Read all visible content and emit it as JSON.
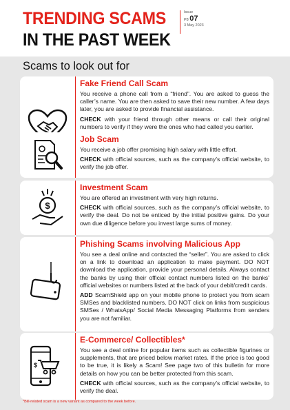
{
  "header": {
    "title_line1": "TRENDING SCAMS",
    "title_line2": "IN THE PAST WEEK",
    "issue_label": "Issue",
    "issue_prefix": "P8",
    "issue_number": "07",
    "issue_date": "3 May 2023"
  },
  "section_title": "Scams to look out for",
  "cards": [
    {
      "title": "Fake Friend Call Scam",
      "icon": "handshake-heart-icon",
      "paragraphs": [
        {
          "bold": "",
          "text": "You receive a phone call from a “friend”. You are asked to guess the caller’s name. You are then asked to save their new number. A few days later, you are asked to provide financial assistance."
        },
        {
          "bold": "CHECK",
          "text": " with your friend through other means or call their original numbers to verify if they were the ones who had called you earlier."
        }
      ]
    },
    {
      "title": "Job Scam",
      "icon": "resume-magnifier-icon",
      "paragraphs": [
        {
          "bold": "",
          "text": "You receive a job offer promising high salary with little effort."
        },
        {
          "bold": "CHECK",
          "text": " with official sources, such as the company’s official website, to verify the job offer."
        }
      ]
    },
    {
      "title": "Investment Scam",
      "icon": "money-hand-icon",
      "paragraphs": [
        {
          "bold": "",
          "text": "You are offered an investment with very high returns."
        },
        {
          "bold": "CHECK",
          "text": " with official sources, such as the company’s official website, to verify the deal. Do not be enticed by the initial positive gains. Do your own due diligence before you invest large sums of money."
        }
      ]
    },
    {
      "title": "Phishing Scams involving Malicious App",
      "icon": "phone-hook-icon",
      "paragraphs": [
        {
          "bold": "",
          "text": "You see a deal online and contacted the “seller”. You are asked to click on a link to download an application to make payment. DO NOT download the application, provide your personal details. Always contact the banks by using their official contact numbers listed on the banks’ official websites or numbers listed at the back of your debit/credit cards."
        },
        {
          "bold": "ADD",
          "text": " ScamShield app on your mobile phone to protect you from scam SMSes and blacklisted numbers. DO NOT click on links from suspicious SMSes / WhatsApp/ Social Media Messaging Platforms from senders you are not familiar."
        }
      ]
    },
    {
      "title": "E-Commerce/ Collectibles*",
      "icon": "phone-cart-icon",
      "paragraphs": [
        {
          "bold": "",
          "text": "You see a deal online for popular items such as collectible figurines or supplements, that are priced below market rates. If the price is too good to be true, it is likely a Scam! See page two of this bulletin for more details on how you can be better protected from this scam."
        },
        {
          "bold": "CHECK",
          "text": " with official sources, such as the company’s official website, to verify the deal."
        }
      ]
    }
  ],
  "footnote": "*Bill-related scam is a new variant as compared to the week before.",
  "colors": {
    "accent": "#e3231b",
    "background": "#e7e7e7",
    "card": "#ffffff"
  }
}
